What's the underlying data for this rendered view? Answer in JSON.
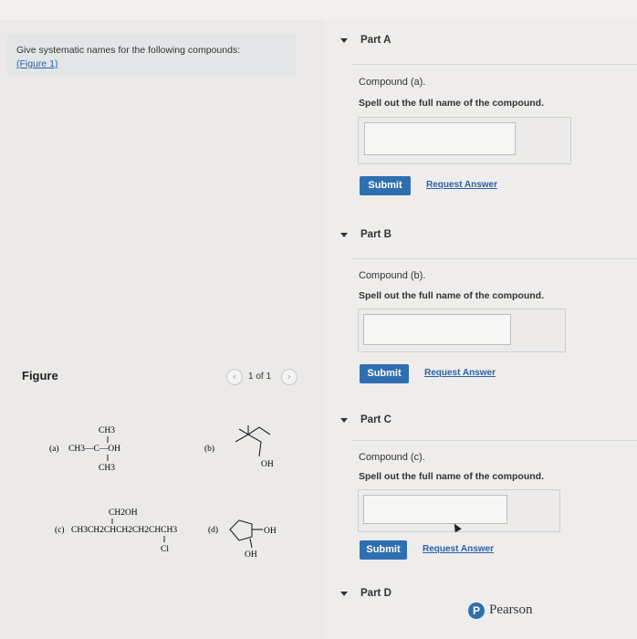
{
  "question": {
    "text": "Give systematic names for the following compounds:",
    "figure_link": "(Figure 1)"
  },
  "figure": {
    "label": "Figure",
    "pagination": "1 of 1",
    "prev_icon": "chevron-left-icon",
    "next_icon": "chevron-right-icon",
    "compounds": {
      "a": {
        "label": "(a)",
        "top": "CH3",
        "main": "CH3—C—OH",
        "bottom": "CH3"
      },
      "b": {
        "label": "(b)",
        "oh": "OH"
      },
      "c": {
        "label": "(c)",
        "top": "CH2OH",
        "main": "CH3CH2CHCH2CH2CHCH3",
        "bottom": "Cl"
      },
      "d": {
        "label": "(d)",
        "oh_right": "OH",
        "oh_bottom": "OH"
      }
    }
  },
  "parts": [
    {
      "header": "Part A",
      "compound": "Compound (a).",
      "instruction": "Spell out the full name of the compound.",
      "input_value": "",
      "submit": "Submit",
      "request": "Request Answer"
    },
    {
      "header": "Part B",
      "compound": "Compound (b).",
      "instruction": "Spell out the full name of the compound.",
      "input_value": "",
      "submit": "Submit",
      "request": "Request Answer"
    },
    {
      "header": "Part C",
      "compound": "Compound (c).",
      "instruction": "Spell out the full name of the compound.",
      "input_value": "",
      "submit": "Submit",
      "request": "Request Answer"
    },
    {
      "header": "Part D"
    }
  ],
  "brand": {
    "logo_letter": "P",
    "name": "Pearson"
  },
  "colors": {
    "accent": "#2f6fb1",
    "link": "#2d61a8",
    "question_box": "#e2e6e7"
  }
}
